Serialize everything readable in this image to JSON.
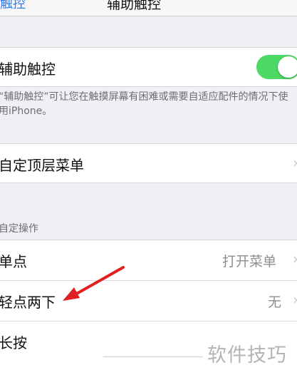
{
  "nav": {
    "back_label": "触控",
    "title": "辅助触控"
  },
  "assistive_touch": {
    "label": "辅助触控",
    "enabled": true,
    "toggle_color": "#4cd964"
  },
  "description": "“辅助触控”可让您在触摸屏幕有困难或需要自适应配件的情况下使用iPhone。",
  "top_menu": {
    "label": "自定顶层菜单"
  },
  "custom_actions": {
    "header": "自定操作",
    "items": [
      {
        "label": "单点",
        "value": "打开菜单"
      },
      {
        "label": "轻点两下",
        "value": "无"
      },
      {
        "label": "长按",
        "value": ""
      }
    ]
  },
  "watermark": "软件技巧",
  "colors": {
    "accent": "#2b7cf6",
    "arrow": "#e02020"
  }
}
